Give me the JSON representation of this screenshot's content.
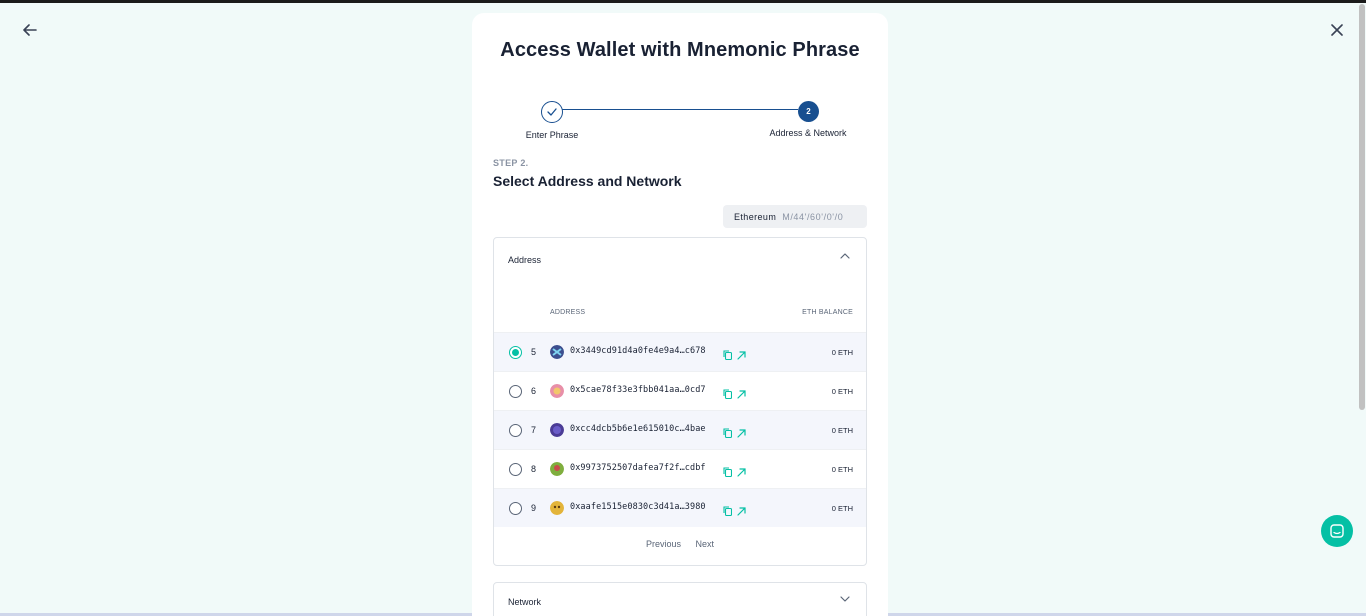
{
  "title": "Access Wallet with Mnemonic Phrase",
  "stepper": {
    "step1_label": "Enter Phrase",
    "step2_number": "2",
    "step2_label": "Address & Network"
  },
  "step": {
    "number_label": "STEP 2.",
    "heading": "Select Address and Network"
  },
  "path_chip": {
    "network": "Ethereum",
    "path": "M/44'/60'/0'/0"
  },
  "address_panel": {
    "header": "Address",
    "col_address": "ADDRESS",
    "col_balance": "ETH BALANCE",
    "rows": [
      {
        "index": "5",
        "address": "0x3449cd91d4a0fe4e9a4…c678",
        "balance": "0 ETH",
        "selected": true
      },
      {
        "index": "6",
        "address": "0x5cae78f33e3fbb041aa…0cd7",
        "balance": "0 ETH",
        "selected": false
      },
      {
        "index": "7",
        "address": "0xcc4dcb5b6e1e615010c…4bae",
        "balance": "0 ETH",
        "selected": false
      },
      {
        "index": "8",
        "address": "0x9973752507dafea7f2f…cdbf",
        "balance": "0 ETH",
        "selected": false
      },
      {
        "index": "9",
        "address": "0xaafe1515e0830c3d41a…3980",
        "balance": "0 ETH",
        "selected": false
      }
    ],
    "previous": "Previous",
    "next": "Next"
  },
  "network_panel": {
    "header": "Network"
  },
  "colors": {
    "background": "#f1faf9",
    "primary": "#184f90",
    "accent": "#05c0a5",
    "text": "#192133"
  },
  "icons": {
    "back": "arrow-left-icon",
    "close": "close-icon",
    "chat": "chat-icon",
    "copy": "copy-icon",
    "external": "external-link-icon"
  }
}
